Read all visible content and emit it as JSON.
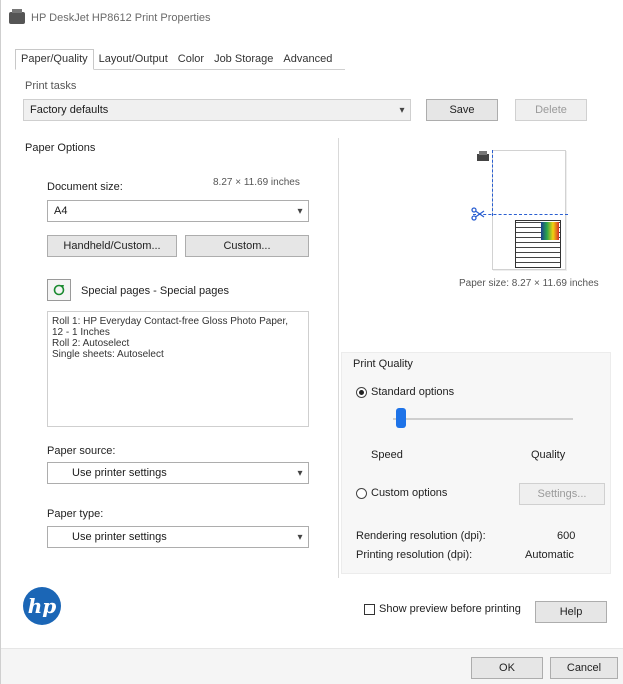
{
  "window": {
    "title": "HP DeskJet HP8612 Print Properties"
  },
  "tabs": [
    {
      "label": "Paper/Quality",
      "active": true
    },
    {
      "label": "Layout/Output"
    },
    {
      "label": "Color"
    },
    {
      "label": "Job Storage"
    },
    {
      "label": "Advanced"
    }
  ],
  "print_tasks": {
    "label": "Print tasks",
    "value": "Factory defaults",
    "save_label": "Save",
    "delete_label": "Delete"
  },
  "paper_options": {
    "section_label": "Paper Options",
    "size_label": "Document size:",
    "size_dims": "8.27 × 11.69 inches",
    "size_value": "A4",
    "custom_button": "Handheld/Custom...",
    "custom2_button": "Custom...",
    "special_pages_label": "Special pages - Special pages",
    "description_lines": [
      "Roll 1: HP Everyday Contact-free Gloss Photo Paper,",
      "  12 - 1 Inches",
      "Roll 2: Autoselect",
      "Single sheets: Autoselect"
    ],
    "source_label": "Paper source:",
    "source_value": "Use printer settings",
    "type_label": "Paper type:",
    "type_value": "Use printer settings"
  },
  "preview": {
    "caption": "Paper size: 8.27 × 11.69 inches"
  },
  "print_quality": {
    "section_label": "Print Quality",
    "standard_label": "Standard options",
    "speed_label": "Speed",
    "quality_label": "Quality",
    "custom_label": "Custom options",
    "settings_button": "Settings...",
    "rendering_label": "Rendering resolution (dpi):",
    "rendering_value": "600",
    "printing_label": "Printing resolution (dpi):",
    "printing_value": "Automatic",
    "slider_position": 0.02
  },
  "footer": {
    "show_preview_label": "Show preview before printing",
    "help_label": "Help",
    "ok_label": "OK",
    "cancel_label": "Cancel"
  },
  "brand": {
    "logo_text": "hp",
    "logo_color": "#1b66b6"
  }
}
